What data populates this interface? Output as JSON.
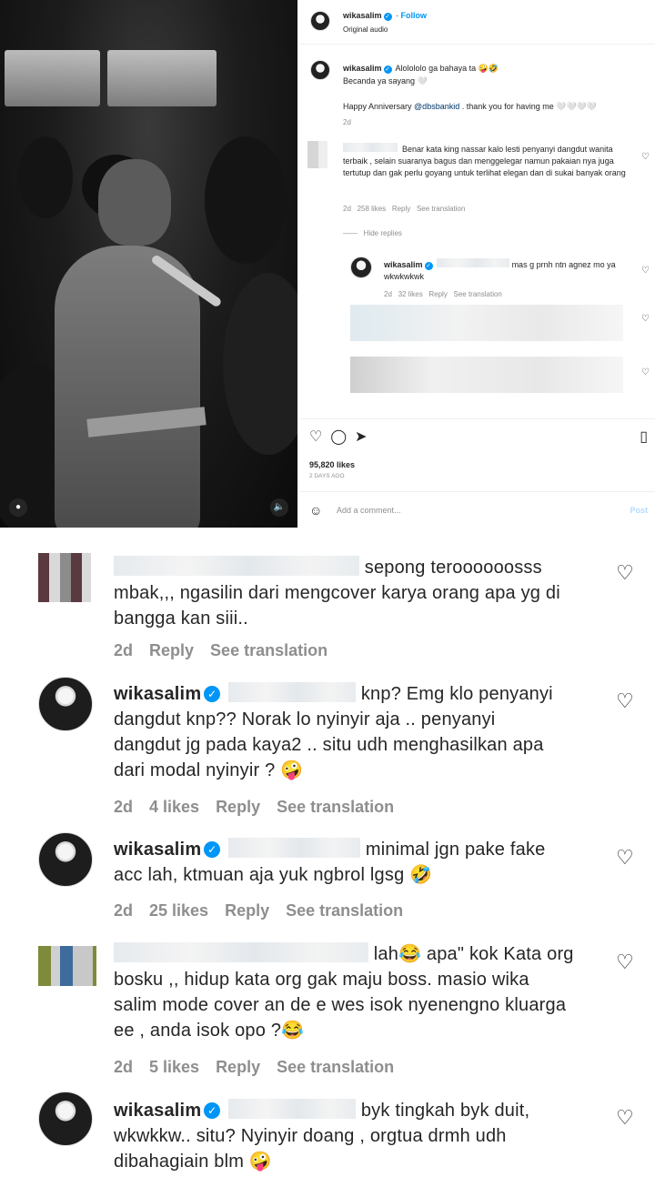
{
  "post": {
    "username": "wikasalim",
    "follow_label": "Follow",
    "audio": "Original audio",
    "caption_line1": "Alolololo ga bahaya ta 🤪🤣",
    "caption_line2": "Becanda ya sayang 🤍",
    "caption_line3a": "Happy Anniversary ",
    "caption_mention": "@dbsbankid",
    "caption_line3b": " . thank you for having me 🤍🤍🤍🤍",
    "caption_time": "2d",
    "comment1_text": "Benar kata king nassar kalo lesti penyanyi dangdut wanita terbaik , selain suaranya bagus dan menggelegar namun pakaian nya juga tertutup dan gak perlu goyang untuk terlihat elegan dan di sukai banyak orang",
    "comment1_meta": {
      "time": "2d",
      "likes": "258 likes",
      "reply": "Reply",
      "translate": "See translation"
    },
    "hide_replies": "Hide replies",
    "reply1_text": "mas g prnh ntn agnez mo ya wkwkwkwk",
    "reply1_meta": {
      "time": "2d",
      "likes": "32 likes",
      "reply": "Reply",
      "translate": "See translation"
    },
    "likes": "95,820 likes",
    "date": "2 DAYS AGO",
    "add_comment_placeholder": "Add a comment...",
    "post_button": "Post"
  },
  "comments": [
    {
      "author": "",
      "text_lines": [
        "sepong teroooooosss",
        "mbak,,, ngasilin dari mengcover karya orang apa yg di",
        "bangga kan siii.."
      ],
      "time": "2d",
      "likes": "",
      "reply": "Reply",
      "translate": "See translation"
    },
    {
      "author": "wikasalim",
      "text_lines": [
        "knp? Emg klo penyanyi",
        "dangdut knp?? Norak lo nyinyir aja .. penyanyi",
        "dangdut jg pada kaya2 .. situ udh menghasilkan apa",
        "dari modal nyinyir ? 🤪"
      ],
      "time": "2d",
      "likes": "4 likes",
      "reply": "Reply",
      "translate": "See translation"
    },
    {
      "author": "wikasalim",
      "text_lines": [
        "minimal jgn pake fake",
        "acc lah, ktmuan aja yuk ngbrol lgsg 🤣"
      ],
      "time": "2d",
      "likes": "25 likes",
      "reply": "Reply",
      "translate": "See translation"
    },
    {
      "author": "",
      "text_lines": [
        "lah😂 apa\" kok Kata org",
        "bosku ,, hidup kata org gak maju boss. masio wika",
        "salim mode cover an de e wes isok nyenengno kluarga",
        "ee , anda isok opo ?😂"
      ],
      "time": "2d",
      "likes": "5 likes",
      "reply": "Reply",
      "translate": "See translation"
    },
    {
      "author": "wikasalim",
      "text_lines": [
        "byk tingkah byk duit,",
        "wkwkkw.. situ? Nyinyir doang , orgtua drmh udh",
        "dibahagiain blm 🤪"
      ],
      "time": "",
      "likes": "",
      "reply": "",
      "translate": ""
    }
  ],
  "icons": [
    "heart-icon",
    "comment-icon",
    "share-icon",
    "bookmark-icon",
    "emoji-icon",
    "verified-icon",
    "mute-icon"
  ],
  "colors": {
    "verified": "#0095f6",
    "meta_gray": "#8e8e8e",
    "text": "#262626",
    "link": "#00376b"
  }
}
